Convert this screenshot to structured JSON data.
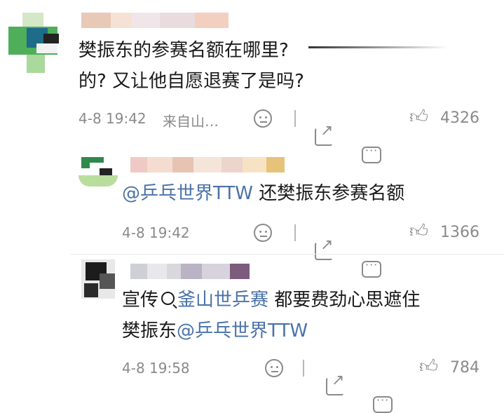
{
  "comments": [
    {
      "text_lines": [
        "樊振东的参赛名额在哪里?",
        "的? 又让他自愿退赛了是吗?"
      ],
      "time": "4-8 19:42",
      "location": "来自山…",
      "likes": "4326",
      "icons": [
        "smiley-icon",
        "share-icon",
        "comment-icon",
        "thumbs-up-icon"
      ]
    },
    {
      "mention": "@乒乓世界TTW",
      "text": " 还樊振东参赛名额",
      "time": "4-8 19:42",
      "likes": "1366"
    },
    {
      "prefix": "宣传",
      "search_term": "釜山世乒赛",
      "text_after_search": " 都要费劲心思遮住",
      "line2_text": "樊振东",
      "line2_mention": "@乒乓世界TTW",
      "time": "4-8 19:58",
      "likes": "784"
    }
  ],
  "colors": {
    "text": "#1a1a1a",
    "meta": "#8a8a8a",
    "link": "#4a72a8"
  }
}
